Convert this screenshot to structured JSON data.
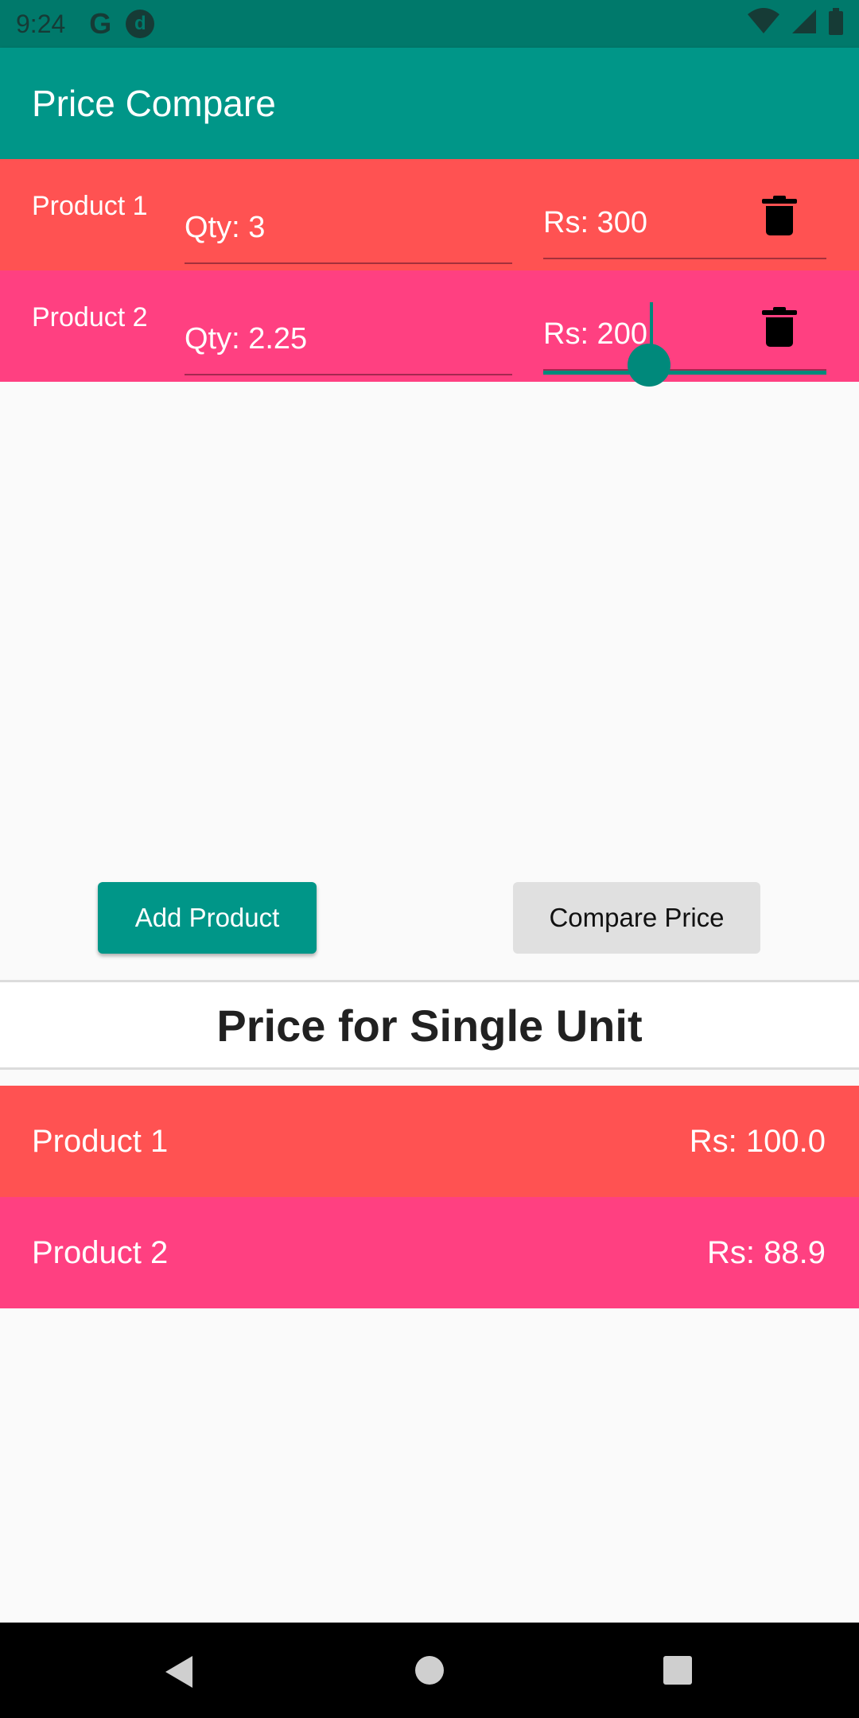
{
  "status_bar": {
    "time": "9:24",
    "google_letter": "G",
    "app_letter": "d",
    "icons": [
      "wifi-icon",
      "signal-icon",
      "battery-icon"
    ]
  },
  "app_bar": {
    "title": "Price Compare"
  },
  "products": [
    {
      "name": "Product 1",
      "qty": "Qty: 3",
      "price": "Rs: 300",
      "color": "#ff5252"
    },
    {
      "name": "Product 2",
      "qty": "Qty: 2.25",
      "price": "Rs: 200",
      "color": "#ff4081"
    }
  ],
  "buttons": {
    "add": "Add Product",
    "compare": "Compare Price"
  },
  "results": {
    "title": "Price for Single Unit",
    "rows": [
      {
        "name": "Product 1",
        "price": "Rs: 100.0",
        "color": "#ff5252"
      },
      {
        "name": "Product 2",
        "price": "Rs: 88.9",
        "color": "#ff4081"
      }
    ]
  },
  "colors": {
    "primary": "#009688",
    "primary_dark": "#00796b",
    "accent_red": "#ff5252",
    "accent_pink": "#ff4081"
  }
}
